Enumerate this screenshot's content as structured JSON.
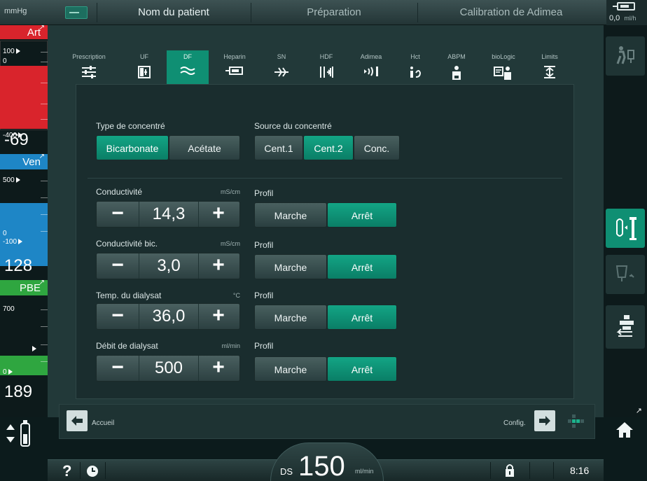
{
  "topbar": {
    "unit": "mmHg",
    "tabs": [
      "Nom du patient",
      "Préparation",
      "Calibration de Adimea"
    ],
    "rate_value": "0,0",
    "rate_unit": "ml/h"
  },
  "pressures": {
    "art": {
      "label": "Art",
      "scale_top": "100",
      "scale_zero": "0",
      "scale_bottom": "-400",
      "value": "-69"
    },
    "ven": {
      "label": "Ven",
      "scale_top": "500",
      "scale_zero": "0",
      "scale_bottom": "-100",
      "value": "128"
    },
    "pbe": {
      "label": "PBE",
      "scale_top": "700",
      "scale_zero": "0",
      "value": "189"
    }
  },
  "tabs": [
    {
      "label": "Prescription",
      "icon": "sliders-icon"
    },
    {
      "label": "UF",
      "icon": "uf-icon"
    },
    {
      "label": "DF",
      "icon": "wave-icon"
    },
    {
      "label": "Heparin",
      "icon": "syringe-icon"
    },
    {
      "label": "SN",
      "icon": "single-needle-icon"
    },
    {
      "label": "HDF",
      "icon": "hdf-icon"
    },
    {
      "label": "Adimea",
      "icon": "adimea-icon"
    },
    {
      "label": "Hct",
      "icon": "hct-icon"
    },
    {
      "label": "ABPM",
      "icon": "abpm-icon"
    },
    {
      "label": "bioLogic",
      "icon": "biologic-icon"
    },
    {
      "label": "Limits",
      "icon": "limits-icon"
    }
  ],
  "concentrate": {
    "type_label": "Type de concentré",
    "type_options": [
      "Bicarbonate",
      "Acétate"
    ],
    "source_label": "Source du concentré",
    "source_options": [
      "Cent.1",
      "Cent.2",
      "Conc."
    ]
  },
  "params": [
    {
      "label": "Conductivité",
      "unit": "mS/cm",
      "value": "14,3"
    },
    {
      "label": "Conductivité bic.",
      "unit": "mS/cm",
      "value": "3,0"
    },
    {
      "label": "Temp. du dialysat",
      "unit": "°C",
      "value": "36,0"
    },
    {
      "label": "Débit de dialysat",
      "unit": "ml/min",
      "value": "500"
    }
  ],
  "profile": {
    "label": "Profil",
    "on": "Marche",
    "off": "Arrêt"
  },
  "nav": {
    "home": "Accueil",
    "config": "Config."
  },
  "status": {
    "blood_pump_label": "DS",
    "blood_pump_value": "150",
    "blood_pump_unit": "ml/min",
    "time": "8:16",
    "help": "?"
  },
  "colors": {
    "accent": "#0f8f73",
    "art": "#d9242c",
    "ven": "#1e86c6",
    "pbe": "#2fa640"
  }
}
